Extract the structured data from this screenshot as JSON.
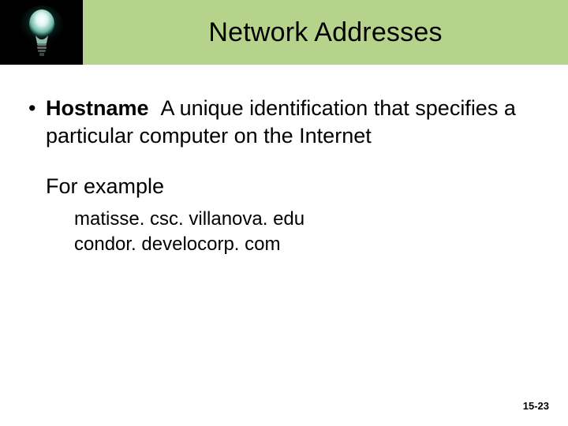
{
  "header": {
    "title": "Network Addresses",
    "icon": "lightbulb-icon"
  },
  "bullet": {
    "term": "Hostname",
    "definition": "A unique identification that specifies a particular computer on the Internet"
  },
  "example_label": "For example",
  "examples": [
    "matisse. csc. villanova. edu",
    "condor. develocorp. com"
  ],
  "page_number": "15-23"
}
